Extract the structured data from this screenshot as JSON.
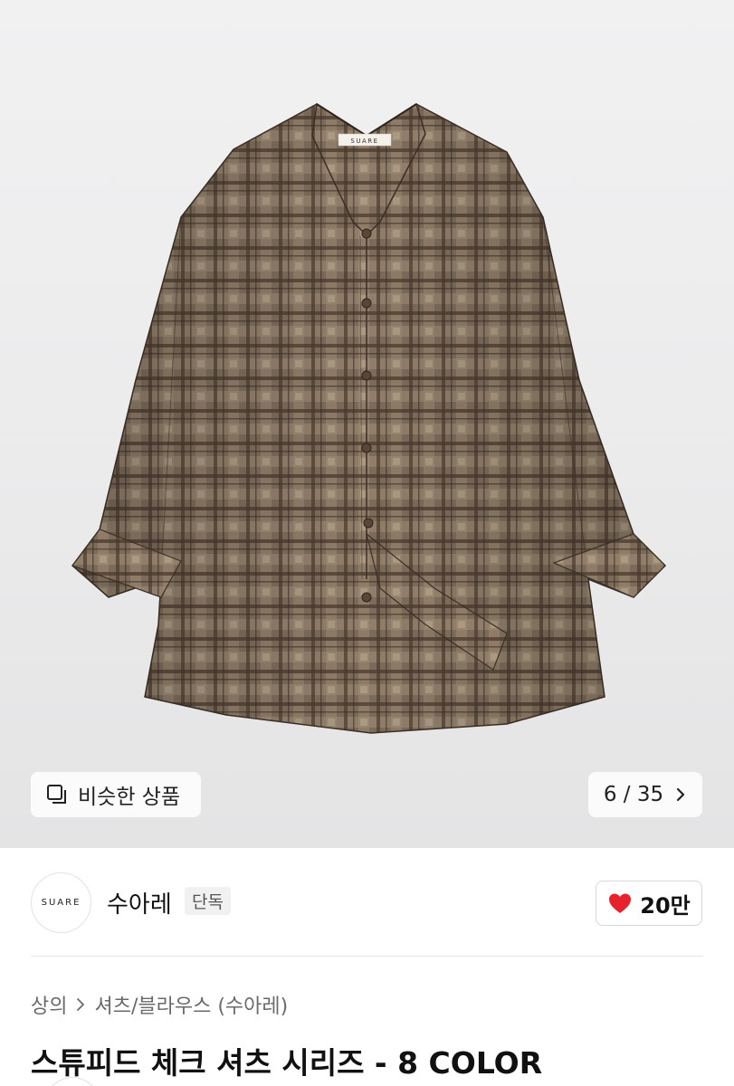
{
  "product_image": {
    "label_tag": "SUARE"
  },
  "similar_button": {
    "label": "비슷한 상품",
    "icon": "similar-items-icon"
  },
  "image_counter": {
    "text": "6 / 35",
    "current": 6,
    "total": 35,
    "icon": "chevron-right-icon"
  },
  "brand": {
    "logo_text": "SUARE",
    "name": "수아레",
    "badge": "단독"
  },
  "like": {
    "count": "20만",
    "icon": "heart-icon",
    "color": "#e8222c"
  },
  "breadcrumb": {
    "category": "상의",
    "subcategory": "셔츠/블라우스 (수아레)"
  },
  "product": {
    "title": "스튜피드 체크 셔츠 시리즈 - 8 COLOR"
  },
  "colors": {
    "shirt_base": "#7a6a58",
    "shirt_dark": "#4e3f31",
    "shirt_light": "#a3917c"
  }
}
